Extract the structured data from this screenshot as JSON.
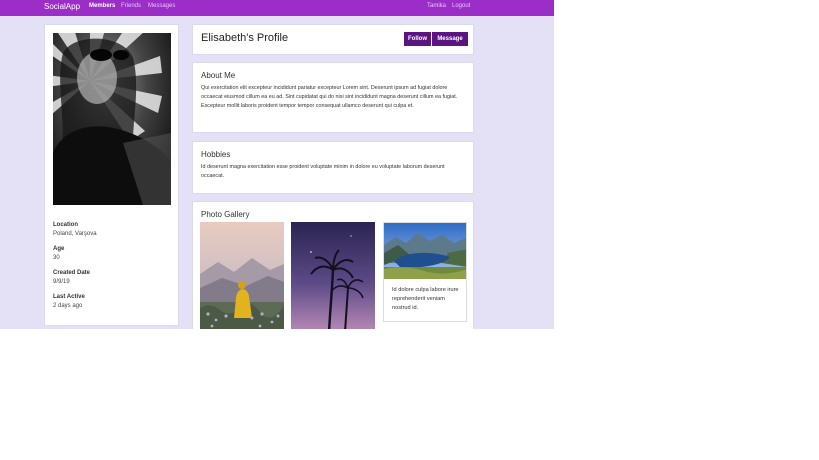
{
  "navbar": {
    "brand": "SocialApp",
    "links": [
      "Members",
      "Friends",
      "Messages"
    ],
    "user": "Tamika",
    "logout": "Logout",
    "color": "#9a2ec7"
  },
  "sidebar": {
    "photo_alt_icon": "profile-photo",
    "stats": [
      {
        "label": "Location",
        "value": "Poland, Varşova"
      },
      {
        "label": "Age",
        "value": "30"
      },
      {
        "label": "Created Date",
        "value": "9/9/19"
      },
      {
        "label": "Last Active",
        "value": "2 days ago"
      }
    ]
  },
  "profile": {
    "title": "Elisabeth's Profile",
    "follow_label": "Follow",
    "message_label": "Message",
    "button_color": "#5b1583"
  },
  "about": {
    "heading": "About Me",
    "text": "Qui exercitation elit excepteur incididunt pariatur excepteur Lorem sint. Deserunt ipsum ad fugiat dolore occaecat eiusmod cillum ea eu ad. Sint cupidatat qui do nisi sint incididunt magna deserunt cillum ea fugiat. Excepteur mollit laboris proident tempor tempor consequat ullamco deserunt qui culpa et."
  },
  "hobbies": {
    "heading": "Hobbies",
    "text": "Id deserunt magna exercitation esse proident voluptate minim in dolore eu voluptate laborum deserunt occaecat."
  },
  "gallery": {
    "heading": "Photo Gallery",
    "caption": "Id dolore culpa labore irure reprehenderit veniam nostrud id."
  },
  "background_color": "#e4e1f7"
}
